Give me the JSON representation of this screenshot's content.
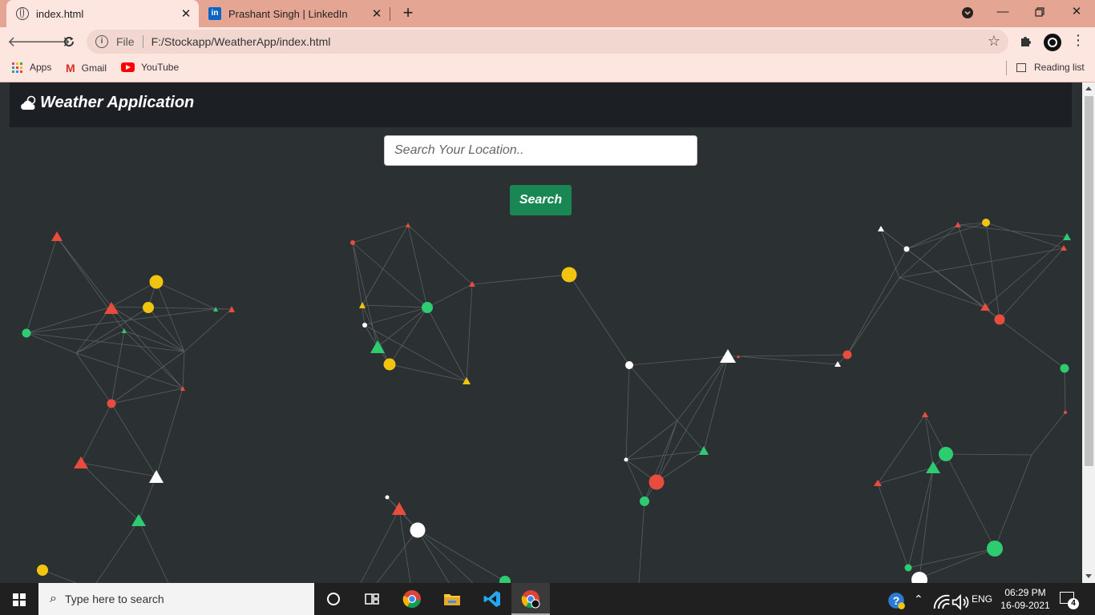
{
  "browser": {
    "tabs": [
      {
        "title": "index.html",
        "active": true
      },
      {
        "title": "Prashant Singh | LinkedIn",
        "active": false
      }
    ],
    "address": {
      "scheme_label": "File",
      "url": "F:/Stockapp/WeatherApp/index.html"
    },
    "bookmarks": [
      {
        "label": "Apps"
      },
      {
        "label": "Gmail"
      },
      {
        "label": "YouTube"
      }
    ],
    "reading_list": "Reading list"
  },
  "app": {
    "brand": "Weather Application",
    "search": {
      "placeholder": "Search Your Location..",
      "button": "Search"
    }
  },
  "taskbar": {
    "search_placeholder": "Type here to search",
    "language": "ENG",
    "time": "06:29 PM",
    "date": "16-09-2021",
    "notification_count": "4"
  },
  "colors": {
    "accent_green": "#198754",
    "particle_red": "#e74c3c",
    "particle_green": "#2ecc71",
    "particle_yellow": "#f1c40f",
    "particle_white": "#ffffff"
  }
}
